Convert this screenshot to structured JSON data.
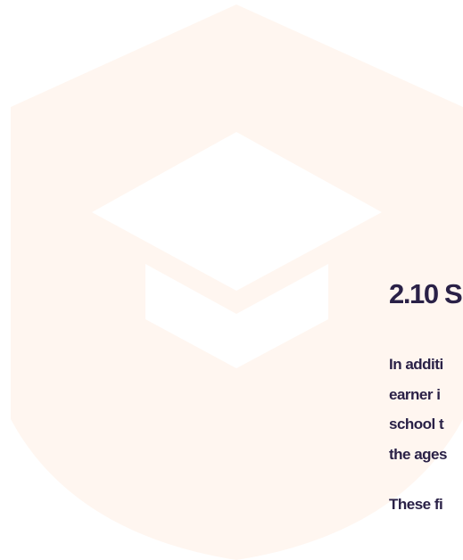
{
  "colors": {
    "background": "#ffffff",
    "shield": "#fff6f0",
    "text": "#2a2147"
  },
  "decoration": {
    "shield_icon": "shield-icon",
    "cap_icon": "graduation-cap-icon"
  },
  "section": {
    "title": "2.10 S",
    "paragraph_1_lines": [
      "In additi",
      "earner i",
      "school t",
      "the ages"
    ],
    "paragraph_2": "These fi"
  }
}
